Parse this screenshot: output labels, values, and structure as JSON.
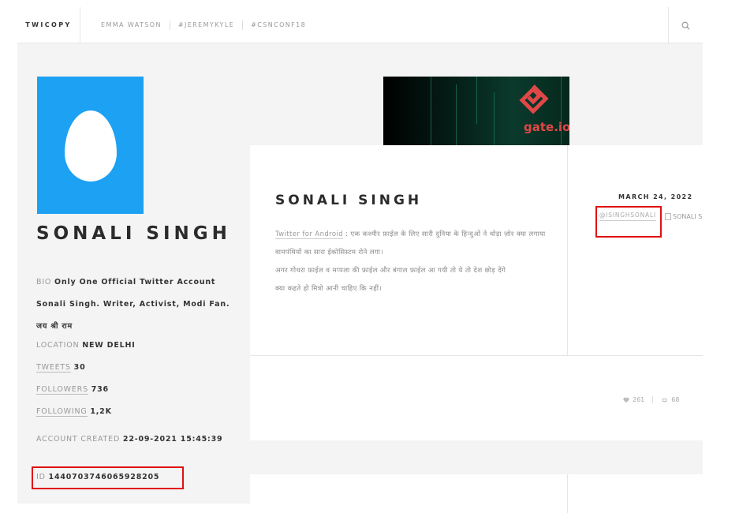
{
  "nav": {
    "brand": "TWICOPY",
    "links": [
      "EMMA WATSON",
      "#JEREMYKYLE",
      "#CSNCONF18"
    ]
  },
  "icons": {
    "search": "search-icon",
    "like": "heart-icon",
    "retweet": "retweet-icon",
    "broken_image": "broken-image-icon"
  },
  "colors": {
    "avatar_bg": "#1da1f2",
    "highlight": "#e01010",
    "ad_accent": "#e04848"
  },
  "profile": {
    "name": "SONALI SINGH",
    "bio_label": "BIO",
    "bio_text": "Only One Official Twitter Account Sonali Singh. Writer, Activist, Modi Fan. जय श्री राम",
    "location_label": "LOCATION",
    "location": "NEW DELHI",
    "tweets_label": "TWEETS",
    "tweets": "30",
    "followers_label": "FOLLOWERS",
    "followers": "736",
    "following_label": "FOLLOWING",
    "following": "1,2K",
    "created_label": "ACCOUNT CREATED",
    "created": "22-09-2021 15:45:39",
    "id_label": "ID",
    "id": "1440703746065928205"
  },
  "ad": {
    "text": "gate.io"
  },
  "tweet": {
    "title": "SONALI SINGH",
    "source": "Twitter for Android",
    "source_sep": " : ",
    "body_line1": "एक कश्मीर फ़ाईल के लिए सारी दुनिया के हिन्दुओं ने थोड़ा ज़ोर क्या लगाया वामपंथियों का सारा ईकोसिस्टम रोने लगा।",
    "body_line2": "अगर गोधरा फ़ाईल व मप्पला की फ़ाईल और बंगाल फ़ाईल आ गयी तो ये तो देश छोड़ देंगे",
    "body_line3": "क्या कहते हो मित्रो आनी चाहिए कि नहीं।",
    "date": "MARCH 24, 2022",
    "handle": "@ISINGHSONALI",
    "image_alt": "SONALI S",
    "likes": "261",
    "retweets": "68"
  }
}
